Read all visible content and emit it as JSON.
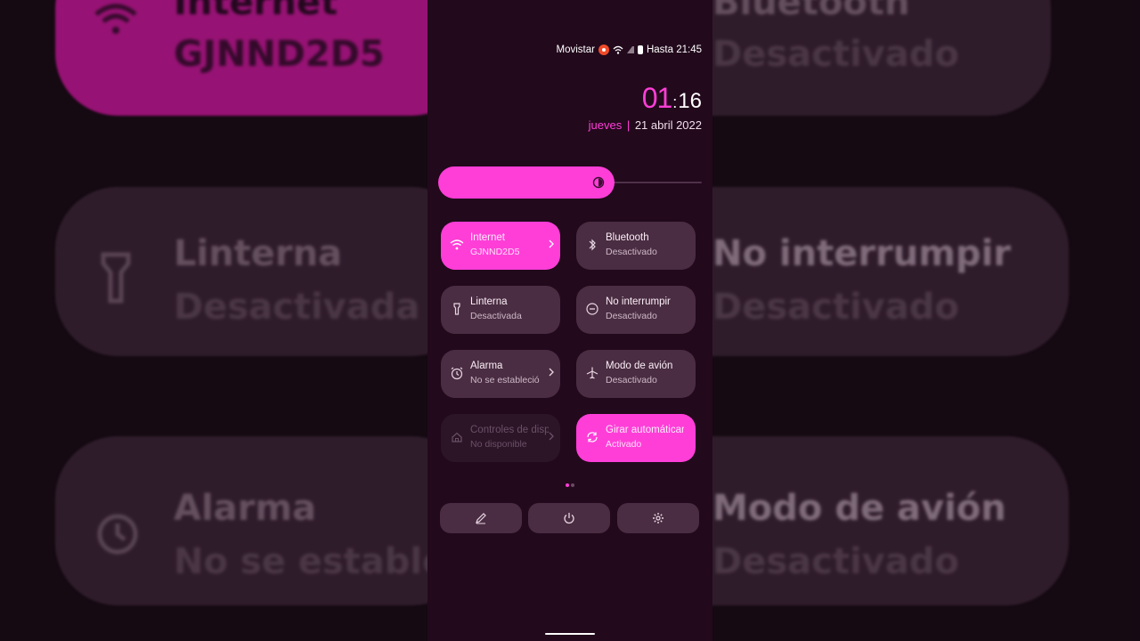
{
  "status_bar": {
    "carrier": "Movistar",
    "alarm_until": "Hasta 21:45"
  },
  "clock": {
    "hour": "01",
    "separator": ":",
    "minute": "16"
  },
  "date": {
    "weekday": "jueves",
    "separator": "|",
    "full_date": "21 abril 2022"
  },
  "brightness": {
    "level": 0.67
  },
  "tiles": [
    {
      "title": "Internet",
      "subtitle": "GJNND2D5",
      "state": "on",
      "icon": "wifi-icon",
      "has_chevron": true
    },
    {
      "title": "Bluetooth",
      "subtitle": "Desactivado",
      "state": "off",
      "icon": "bluetooth-icon",
      "has_chevron": false
    },
    {
      "title": "Linterna",
      "subtitle": "Desactivada",
      "state": "off",
      "icon": "flashlight-icon",
      "has_chevron": false
    },
    {
      "title": "No interrumpir",
      "subtitle": "Desactivado",
      "state": "off",
      "icon": "do-not-disturb-icon",
      "has_chevron": false
    },
    {
      "title": "Alarma",
      "subtitle": "No se estableció",
      "state": "off",
      "icon": "alarm-clock-icon",
      "has_chevron": true
    },
    {
      "title": "Modo de avión",
      "subtitle": "Desactivado",
      "state": "off",
      "icon": "airplane-icon",
      "has_chevron": false
    },
    {
      "title": "Controles de dispositivos",
      "subtitle": "No disponible",
      "state": "disabled",
      "icon": "home-icon",
      "has_chevron": true
    },
    {
      "title": "Girar automáticamente",
      "subtitle": "Activado",
      "state": "on",
      "icon": "auto-rotate-icon",
      "has_chevron": false
    }
  ],
  "pagination": {
    "pages": 2,
    "current": 1
  },
  "bottom_actions": [
    {
      "icon": "edit-pencil-icon"
    },
    {
      "icon": "power-icon"
    },
    {
      "icon": "settings-gear-icon"
    }
  ],
  "background_zoom": {
    "left": [
      {
        "title": "Internet",
        "subtitle": "GJNND2D5"
      },
      {
        "title": "Linterna",
        "subtitle": "Desactivada"
      },
      {
        "title": "Alarma",
        "subtitle": "No se estableció"
      }
    ],
    "right": [
      {
        "title": "Bluetooth",
        "subtitle": "Desactivado"
      },
      {
        "title": "No interrumpir",
        "subtitle": "Desactivado"
      },
      {
        "title": "Modo de avión",
        "subtitle": "Desactivado"
      }
    ]
  },
  "colors": {
    "accent": "#ff3ed8",
    "panel_bg": "#22091c",
    "tile_off": "#4a2d42"
  }
}
